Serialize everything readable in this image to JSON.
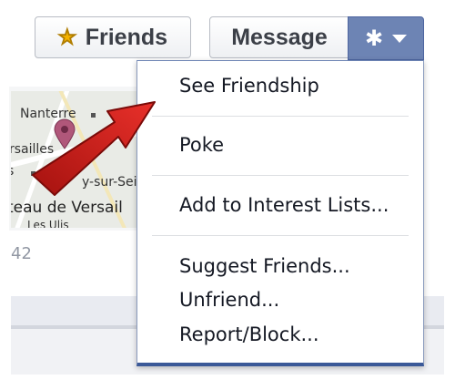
{
  "actions": {
    "friends_label": "Friends",
    "friends_icon": "star-icon",
    "message_label": "Message",
    "settings_icon": "gear-icon",
    "dropdown_icon": "caret-down-icon"
  },
  "menu": {
    "see_friendship": "See Friendship",
    "poke": "Poke",
    "add_to_interest_lists": "Add to Interest Lists...",
    "suggest_friends": "Suggest Friends...",
    "unfriend": "Unfriend...",
    "report_block": "Report/Block..."
  },
  "map": {
    "place_nanterre": "Nanterre",
    "place_versailles": "rsailles",
    "place_sur_seine": "y-sur-Sein",
    "place_chateau": "teau de Versail",
    "place_les_ulis": "Les Ulis",
    "count": "42",
    "pin_icon": "map-pin-icon"
  },
  "colors": {
    "accent": "#6d84b4",
    "menu_border": "#3b5998",
    "arrow": "#d9221f",
    "star": "#f5b300",
    "pin": "#b0577a"
  }
}
